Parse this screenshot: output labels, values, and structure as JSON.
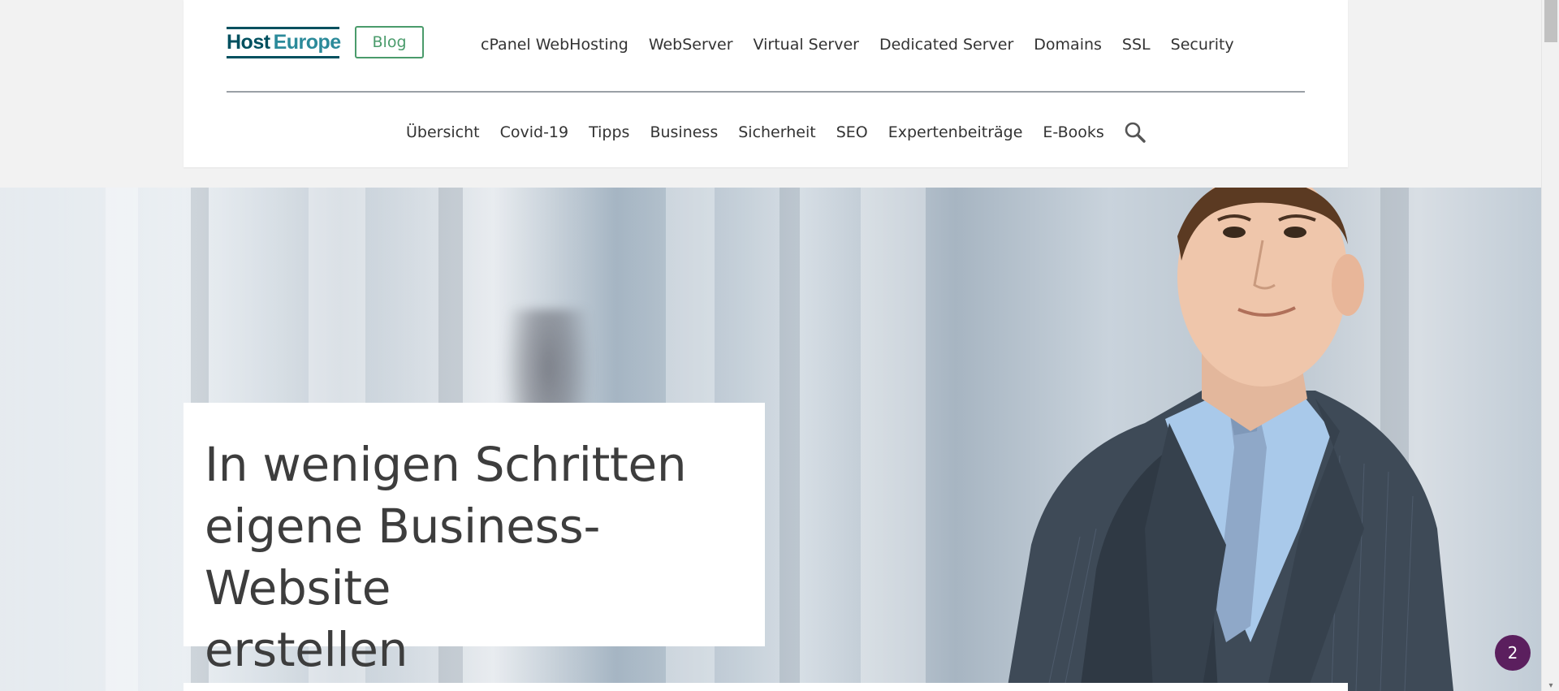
{
  "brand": {
    "logo_host": "Host",
    "logo_europe": "Europe",
    "blog_label": "Blog",
    "colors": {
      "brand_teal": "#00505f",
      "blog_green": "#4a9b6b",
      "badge_purple": "#5b1f5e"
    }
  },
  "top_nav": [
    {
      "label": "cPanel WebHosting"
    },
    {
      "label": "WebServer"
    },
    {
      "label": "Virtual Server"
    },
    {
      "label": "Dedicated Server"
    },
    {
      "label": "Domains"
    },
    {
      "label": "SSL"
    },
    {
      "label": "Security"
    }
  ],
  "sub_nav": [
    {
      "label": "Übersicht"
    },
    {
      "label": "Covid-19"
    },
    {
      "label": "Tipps"
    },
    {
      "label": "Business"
    },
    {
      "label": "Sicherheit"
    },
    {
      "label": "SEO"
    },
    {
      "label": "Expertenbeiträge"
    },
    {
      "label": "E-Books"
    }
  ],
  "search": {
    "icon": "search-icon"
  },
  "hero": {
    "title_line1": "In wenigen Schritten",
    "title_line2": "eigene Business-Website",
    "title_line3": "erstellen"
  },
  "notification": {
    "count": "2"
  }
}
